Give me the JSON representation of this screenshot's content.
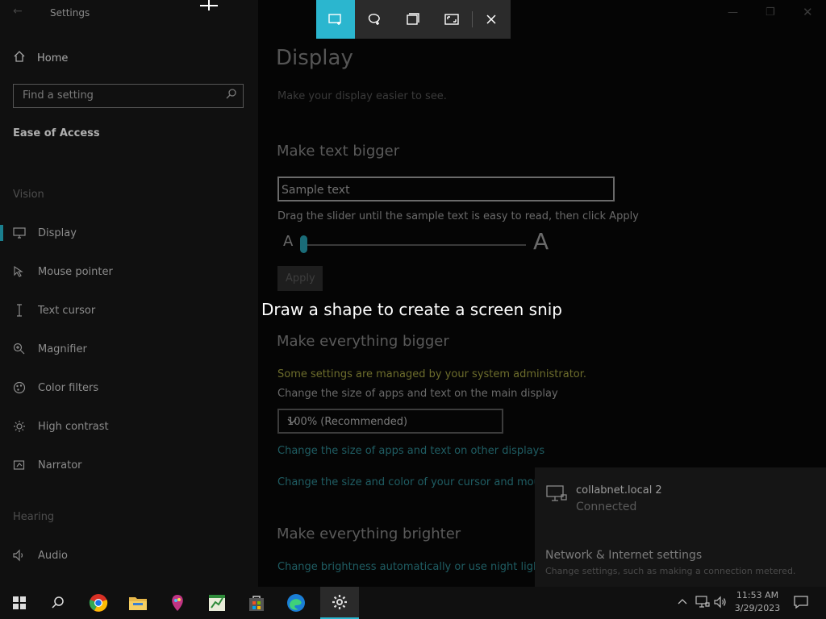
{
  "window": {
    "title": "Settings"
  },
  "sidebar": {
    "home_label": "Home",
    "search_placeholder": "Find a setting",
    "section": "Ease of Access",
    "groups": {
      "vision": "Vision",
      "hearing": "Hearing"
    },
    "items": [
      {
        "label": "Display",
        "icon": "monitor-icon"
      },
      {
        "label": "Mouse pointer",
        "icon": "mouse-pointer-icon"
      },
      {
        "label": "Text cursor",
        "icon": "text-cursor-icon"
      },
      {
        "label": "Magnifier",
        "icon": "magnifier-icon"
      },
      {
        "label": "Color filters",
        "icon": "color-filters-icon"
      },
      {
        "label": "High contrast",
        "icon": "high-contrast-icon"
      },
      {
        "label": "Narrator",
        "icon": "narrator-icon"
      },
      {
        "label": "Audio",
        "icon": "audio-icon"
      }
    ]
  },
  "main": {
    "title": "Display",
    "subtitle": "Make your display easier to see.",
    "text_bigger": {
      "heading": "Make text bigger",
      "sample": "Sample text",
      "hint": "Drag the slider until the sample text is easy to read, then click Apply",
      "small_a": "A",
      "large_a": "A",
      "slider_value_percent": 0,
      "apply_label": "Apply"
    },
    "everything_bigger": {
      "heading": "Make everything bigger",
      "admin_note": "Some settings are managed by your system administrator.",
      "scale_label": "Change the size of apps and text on the main display",
      "scale_value": "100% (Recommended)",
      "link_other_displays": "Change the size of apps and text on other displays",
      "link_cursor": "Change the size and color of your cursor and mouse"
    },
    "everything_brighter": {
      "heading": "Make everything brighter",
      "link_brightness": "Change brightness automatically or use night light"
    }
  },
  "snip": {
    "message": "Draw a shape to create a screen snip",
    "tools": [
      "rectangular-snip-icon",
      "freeform-snip-icon",
      "window-snip-icon",
      "fullscreen-snip-icon",
      "close-icon"
    ],
    "accent": "#2bb6cf"
  },
  "network": {
    "name": "collabnet.local 2",
    "status": "Connected",
    "settings_title": "Network & Internet settings",
    "settings_desc": "Change settings, such as making a connection metered."
  },
  "taskbar": {
    "time": "11:53 AM",
    "date": "3/29/2023",
    "apps": [
      "windows-start-icon",
      "search-icon",
      "chrome-icon",
      "file-explorer-icon",
      "paint-icon",
      "spreadsheet-icon",
      "store-icon",
      "edge-icon",
      "settings-gear-icon"
    ]
  }
}
